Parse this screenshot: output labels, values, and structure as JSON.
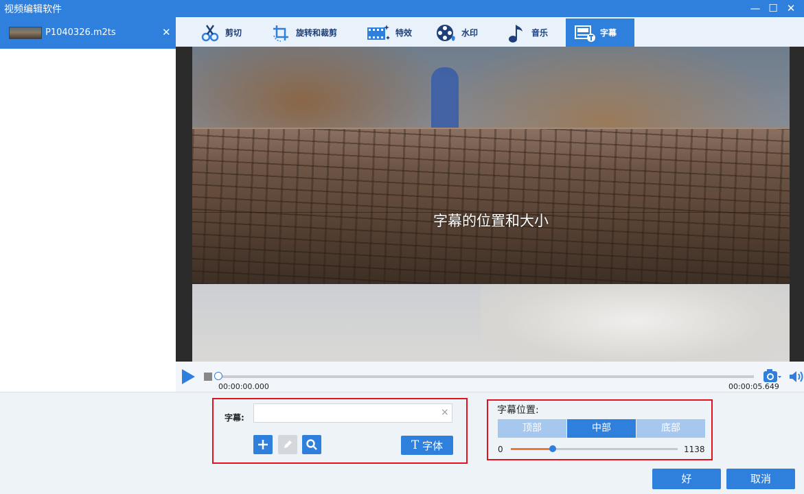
{
  "window": {
    "title": "视频编辑软件",
    "min_glyph": "—",
    "max_glyph": "☐",
    "close_glyph": "✕"
  },
  "files": [
    {
      "name": "P1040326.m2ts",
      "close_glyph": "✕"
    }
  ],
  "tabs": [
    {
      "label": "剪切",
      "icon": "scissors-icon"
    },
    {
      "label": "旋转和裁剪",
      "icon": "crop-rotate-icon"
    },
    {
      "label": "特效",
      "icon": "film-effects-icon"
    },
    {
      "label": "水印",
      "icon": "watermark-reel-icon"
    },
    {
      "label": "音乐",
      "icon": "music-note-icon"
    },
    {
      "label": "字幕",
      "icon": "subtitle-icon",
      "active": true
    }
  ],
  "preview": {
    "subtitle_text": "字幕的位置和大小"
  },
  "player": {
    "time_current": "00:00:00.000",
    "time_total": "00:00:05.649",
    "progress_fraction": 0.0
  },
  "subtitle_editor": {
    "label": "字幕:",
    "input_value": "",
    "clear_glyph": "×",
    "font_button_icon": "T",
    "font_button_label": "字体"
  },
  "subtitle_position": {
    "label": "字幕位置:",
    "options": [
      "顶部",
      "中部",
      "底部"
    ],
    "selected": "中部",
    "slider_min": "0",
    "slider_max": "1138",
    "slider_value": 285
  },
  "footer": {
    "ok_label": "好",
    "cancel_label": "取消"
  },
  "colors": {
    "accent": "#2f7fdc",
    "highlight_box": "#e4101c",
    "slider_fill": "#f0782e"
  }
}
